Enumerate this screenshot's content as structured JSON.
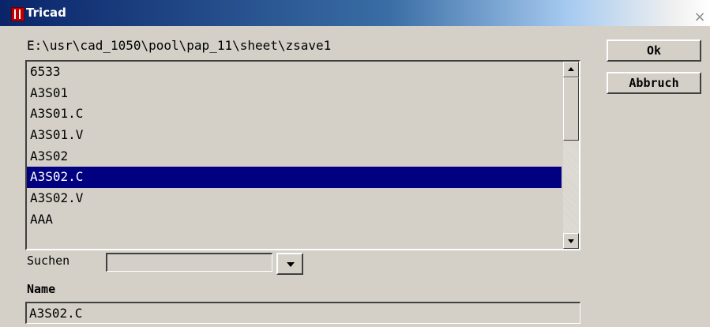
{
  "window": {
    "title": "Tricad",
    "close_glyph": "×"
  },
  "path": "E:\\usr\\cad_1050\\pool\\pap_11\\sheet\\zsave1",
  "buttons": {
    "ok_label": "Ok",
    "cancel_label": "Abbruch"
  },
  "list": {
    "items": [
      {
        "label": "6533",
        "selected": false
      },
      {
        "label": "A3S01",
        "selected": false
      },
      {
        "label": "A3S01.C",
        "selected": false
      },
      {
        "label": "A3S01.V",
        "selected": false
      },
      {
        "label": "A3S02",
        "selected": false
      },
      {
        "label": "A3S02.C",
        "selected": true
      },
      {
        "label": "A3S02.V",
        "selected": false
      },
      {
        "label": "AAA",
        "selected": false
      }
    ]
  },
  "search": {
    "label": "Suchen",
    "value": ""
  },
  "name": {
    "label": "Name",
    "value": "A3S02.C"
  },
  "icons": {
    "app": "tricad-app-icon",
    "close": "close-icon",
    "dropdown": "chevron-down-icon"
  }
}
